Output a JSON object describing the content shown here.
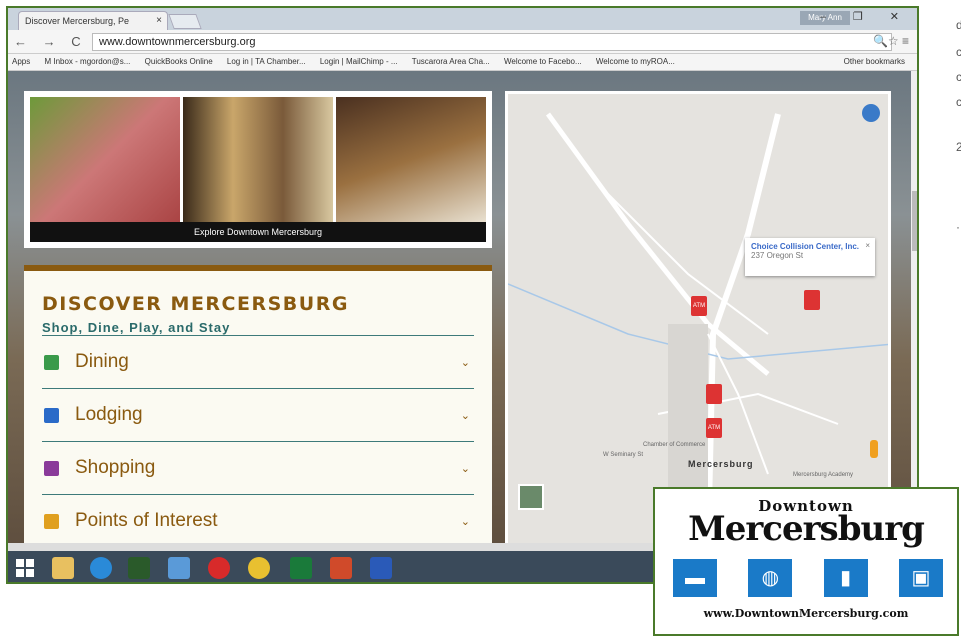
{
  "browser": {
    "tab_title": "Discover Mercersburg, Pe",
    "tab_close": "×",
    "user_label": "Mary Ann",
    "window_controls": "– ❐ ✕",
    "nav_glyphs": "← → C ⌂",
    "url": "www.downtownmercersburg.org",
    "url_icons": "🔍☆ ≡",
    "bookmarks": [
      "Apps",
      "M Inbox - mgordon@s...",
      "QuickBooks Online",
      "Log in | TA Chamber...",
      "Login | MailChimp - ...",
      "Tuscarora Area Cha...",
      "Welcome to Facebo...",
      "Welcome to myROA..."
    ],
    "other_bookmarks": "Other bookmarks"
  },
  "hero": {
    "caption": "Explore Downtown Mercersburg"
  },
  "panel": {
    "title": "DISCOVER MERCERSBURG",
    "subtitle": "Shop, Dine, Play, and Stay",
    "categories": [
      {
        "label": "Dining",
        "icon": "dining-icon",
        "color": "#3a9a4a"
      },
      {
        "label": "Lodging",
        "icon": "lodging-icon",
        "color": "#2a6ac8"
      },
      {
        "label": "Shopping",
        "icon": "shopping-icon",
        "color": "#8a3a9a"
      },
      {
        "label": "Points of Interest",
        "icon": "poi-icon",
        "color": "#e0a020"
      }
    ],
    "chevron": "⌄"
  },
  "map": {
    "info_name": "Choice Collision Center, Inc.",
    "info_address": "237 Oregon St",
    "info_close": "×",
    "town": "Mercersburg",
    "labels": [
      "Chamber of Commerce",
      "Mercersburg Academy",
      "W Seminary St"
    ],
    "pin_atm": "ATM",
    "zoom_in": "+"
  },
  "edge_chars": [
    "d",
    "c",
    "c",
    "c",
    "2",
    "·"
  ],
  "logo": {
    "line1": "Downtown",
    "line2": "Mercersburg",
    "url": "www.DowntownMercersburg.com",
    "icons": [
      "bed-icon",
      "dining-icon",
      "gas-icon",
      "shopping-icon"
    ]
  }
}
